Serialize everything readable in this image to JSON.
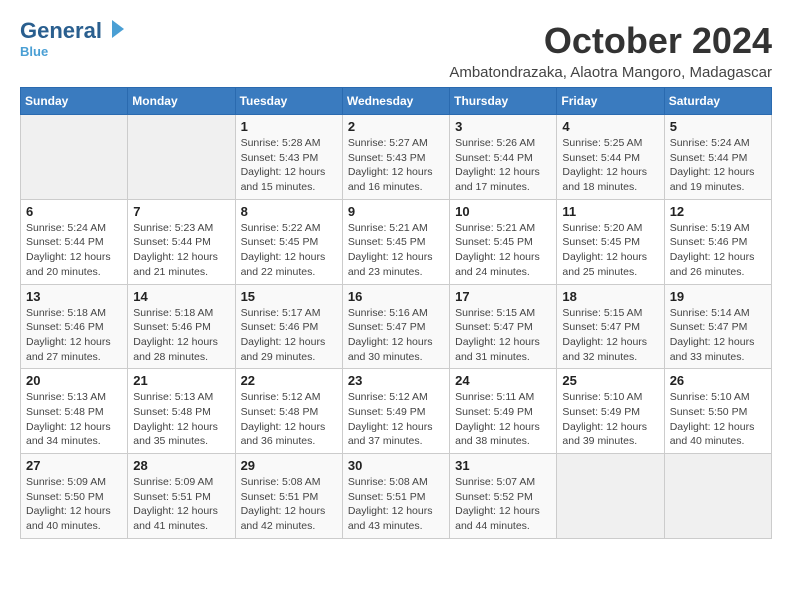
{
  "header": {
    "logo_line1": "General",
    "logo_line2": "Blue",
    "month_title": "October 2024",
    "location": "Ambatondrazaka, Alaotra Mangoro, Madagascar"
  },
  "weekdays": [
    "Sunday",
    "Monday",
    "Tuesday",
    "Wednesday",
    "Thursday",
    "Friday",
    "Saturday"
  ],
  "weeks": [
    [
      {
        "day": "",
        "info": ""
      },
      {
        "day": "",
        "info": ""
      },
      {
        "day": "1",
        "info": "Sunrise: 5:28 AM\nSunset: 5:43 PM\nDaylight: 12 hours\nand 15 minutes."
      },
      {
        "day": "2",
        "info": "Sunrise: 5:27 AM\nSunset: 5:43 PM\nDaylight: 12 hours\nand 16 minutes."
      },
      {
        "day": "3",
        "info": "Sunrise: 5:26 AM\nSunset: 5:44 PM\nDaylight: 12 hours\nand 17 minutes."
      },
      {
        "day": "4",
        "info": "Sunrise: 5:25 AM\nSunset: 5:44 PM\nDaylight: 12 hours\nand 18 minutes."
      },
      {
        "day": "5",
        "info": "Sunrise: 5:24 AM\nSunset: 5:44 PM\nDaylight: 12 hours\nand 19 minutes."
      }
    ],
    [
      {
        "day": "6",
        "info": "Sunrise: 5:24 AM\nSunset: 5:44 PM\nDaylight: 12 hours\nand 20 minutes."
      },
      {
        "day": "7",
        "info": "Sunrise: 5:23 AM\nSunset: 5:44 PM\nDaylight: 12 hours\nand 21 minutes."
      },
      {
        "day": "8",
        "info": "Sunrise: 5:22 AM\nSunset: 5:45 PM\nDaylight: 12 hours\nand 22 minutes."
      },
      {
        "day": "9",
        "info": "Sunrise: 5:21 AM\nSunset: 5:45 PM\nDaylight: 12 hours\nand 23 minutes."
      },
      {
        "day": "10",
        "info": "Sunrise: 5:21 AM\nSunset: 5:45 PM\nDaylight: 12 hours\nand 24 minutes."
      },
      {
        "day": "11",
        "info": "Sunrise: 5:20 AM\nSunset: 5:45 PM\nDaylight: 12 hours\nand 25 minutes."
      },
      {
        "day": "12",
        "info": "Sunrise: 5:19 AM\nSunset: 5:46 PM\nDaylight: 12 hours\nand 26 minutes."
      }
    ],
    [
      {
        "day": "13",
        "info": "Sunrise: 5:18 AM\nSunset: 5:46 PM\nDaylight: 12 hours\nand 27 minutes."
      },
      {
        "day": "14",
        "info": "Sunrise: 5:18 AM\nSunset: 5:46 PM\nDaylight: 12 hours\nand 28 minutes."
      },
      {
        "day": "15",
        "info": "Sunrise: 5:17 AM\nSunset: 5:46 PM\nDaylight: 12 hours\nand 29 minutes."
      },
      {
        "day": "16",
        "info": "Sunrise: 5:16 AM\nSunset: 5:47 PM\nDaylight: 12 hours\nand 30 minutes."
      },
      {
        "day": "17",
        "info": "Sunrise: 5:15 AM\nSunset: 5:47 PM\nDaylight: 12 hours\nand 31 minutes."
      },
      {
        "day": "18",
        "info": "Sunrise: 5:15 AM\nSunset: 5:47 PM\nDaylight: 12 hours\nand 32 minutes."
      },
      {
        "day": "19",
        "info": "Sunrise: 5:14 AM\nSunset: 5:47 PM\nDaylight: 12 hours\nand 33 minutes."
      }
    ],
    [
      {
        "day": "20",
        "info": "Sunrise: 5:13 AM\nSunset: 5:48 PM\nDaylight: 12 hours\nand 34 minutes."
      },
      {
        "day": "21",
        "info": "Sunrise: 5:13 AM\nSunset: 5:48 PM\nDaylight: 12 hours\nand 35 minutes."
      },
      {
        "day": "22",
        "info": "Sunrise: 5:12 AM\nSunset: 5:48 PM\nDaylight: 12 hours\nand 36 minutes."
      },
      {
        "day": "23",
        "info": "Sunrise: 5:12 AM\nSunset: 5:49 PM\nDaylight: 12 hours\nand 37 minutes."
      },
      {
        "day": "24",
        "info": "Sunrise: 5:11 AM\nSunset: 5:49 PM\nDaylight: 12 hours\nand 38 minutes."
      },
      {
        "day": "25",
        "info": "Sunrise: 5:10 AM\nSunset: 5:49 PM\nDaylight: 12 hours\nand 39 minutes."
      },
      {
        "day": "26",
        "info": "Sunrise: 5:10 AM\nSunset: 5:50 PM\nDaylight: 12 hours\nand 40 minutes."
      }
    ],
    [
      {
        "day": "27",
        "info": "Sunrise: 5:09 AM\nSunset: 5:50 PM\nDaylight: 12 hours\nand 40 minutes."
      },
      {
        "day": "28",
        "info": "Sunrise: 5:09 AM\nSunset: 5:51 PM\nDaylight: 12 hours\nand 41 minutes."
      },
      {
        "day": "29",
        "info": "Sunrise: 5:08 AM\nSunset: 5:51 PM\nDaylight: 12 hours\nand 42 minutes."
      },
      {
        "day": "30",
        "info": "Sunrise: 5:08 AM\nSunset: 5:51 PM\nDaylight: 12 hours\nand 43 minutes."
      },
      {
        "day": "31",
        "info": "Sunrise: 5:07 AM\nSunset: 5:52 PM\nDaylight: 12 hours\nand 44 minutes."
      },
      {
        "day": "",
        "info": ""
      },
      {
        "day": "",
        "info": ""
      }
    ]
  ]
}
